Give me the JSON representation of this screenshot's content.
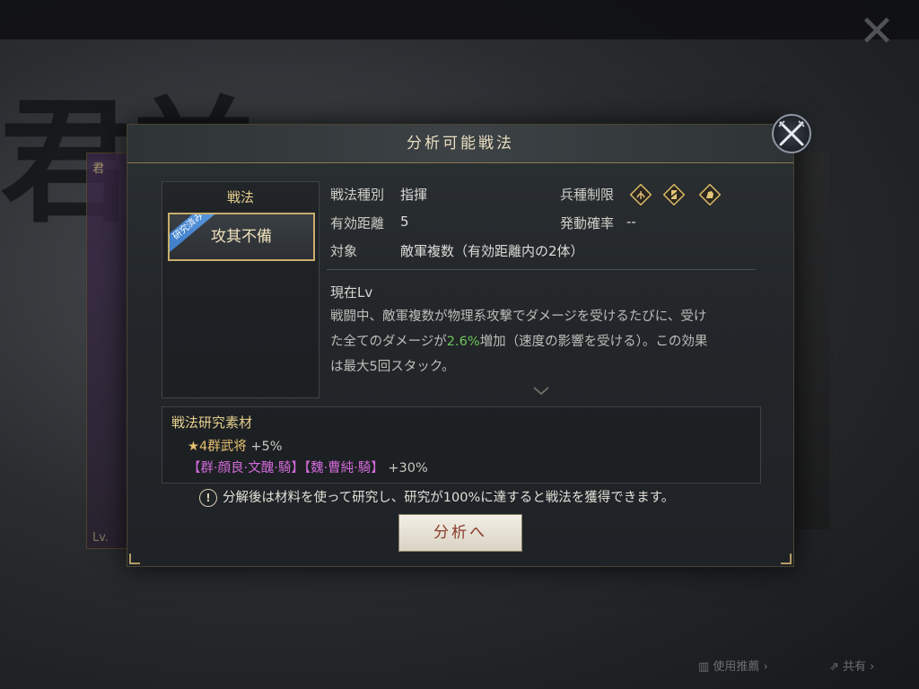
{
  "background": {
    "big_char": "君羊",
    "left_card_title": "君",
    "left_card_level": "Lv.",
    "bottom_buttons": [
      {
        "label": "使用推薦"
      },
      {
        "label": "共有"
      }
    ]
  },
  "dialog": {
    "title": "分析可能戦法",
    "tactic_panel": {
      "title": "戦法",
      "items": [
        {
          "label": "攻其不備",
          "ribbon": "研究済み",
          "selected": true
        }
      ]
    },
    "info": {
      "type_label": "戦法種別",
      "type_value": "指揮",
      "range_label": "有効距離",
      "range_value": "5",
      "target_label": "対象",
      "target_value": "敵軍複数（有効距離内の2体）",
      "unit_label": "兵種制限",
      "unit_icons": [
        "bow-cavalry-icon",
        "shield-icon",
        "cavalry-icon"
      ],
      "rate_label": "発動確率",
      "rate_value": "--"
    },
    "description": {
      "title": "現在Lv",
      "line1": "戦闘中、敵軍複数が物理系攻撃でダメージを受けるたびに、受け",
      "line2_pre": "た全てのダメージが",
      "line2_hl": "2.6%",
      "line2_post": "増加（速度の影響を受ける）。この効果",
      "line3": "は最大5回スタック。"
    },
    "materials": {
      "title": "戦法研究素材",
      "item1_name": "★4群武将",
      "item1_bonus": "+5%",
      "item2_name": "【群·顔良·文醜·騎】【魏·曹純·騎】",
      "item2_bonus": "+30%"
    },
    "notice": "分解後は材料を使って研究し、研究が100%に達すると戦法を獲得できます。",
    "notice_icon": "!",
    "analyze_button": "分析へ"
  },
  "colors": {
    "gold": "#e6c070",
    "pink": "#d36ad9",
    "highlight_green": "#6ec45a",
    "ribbon_blue": "#3c7bc8"
  }
}
